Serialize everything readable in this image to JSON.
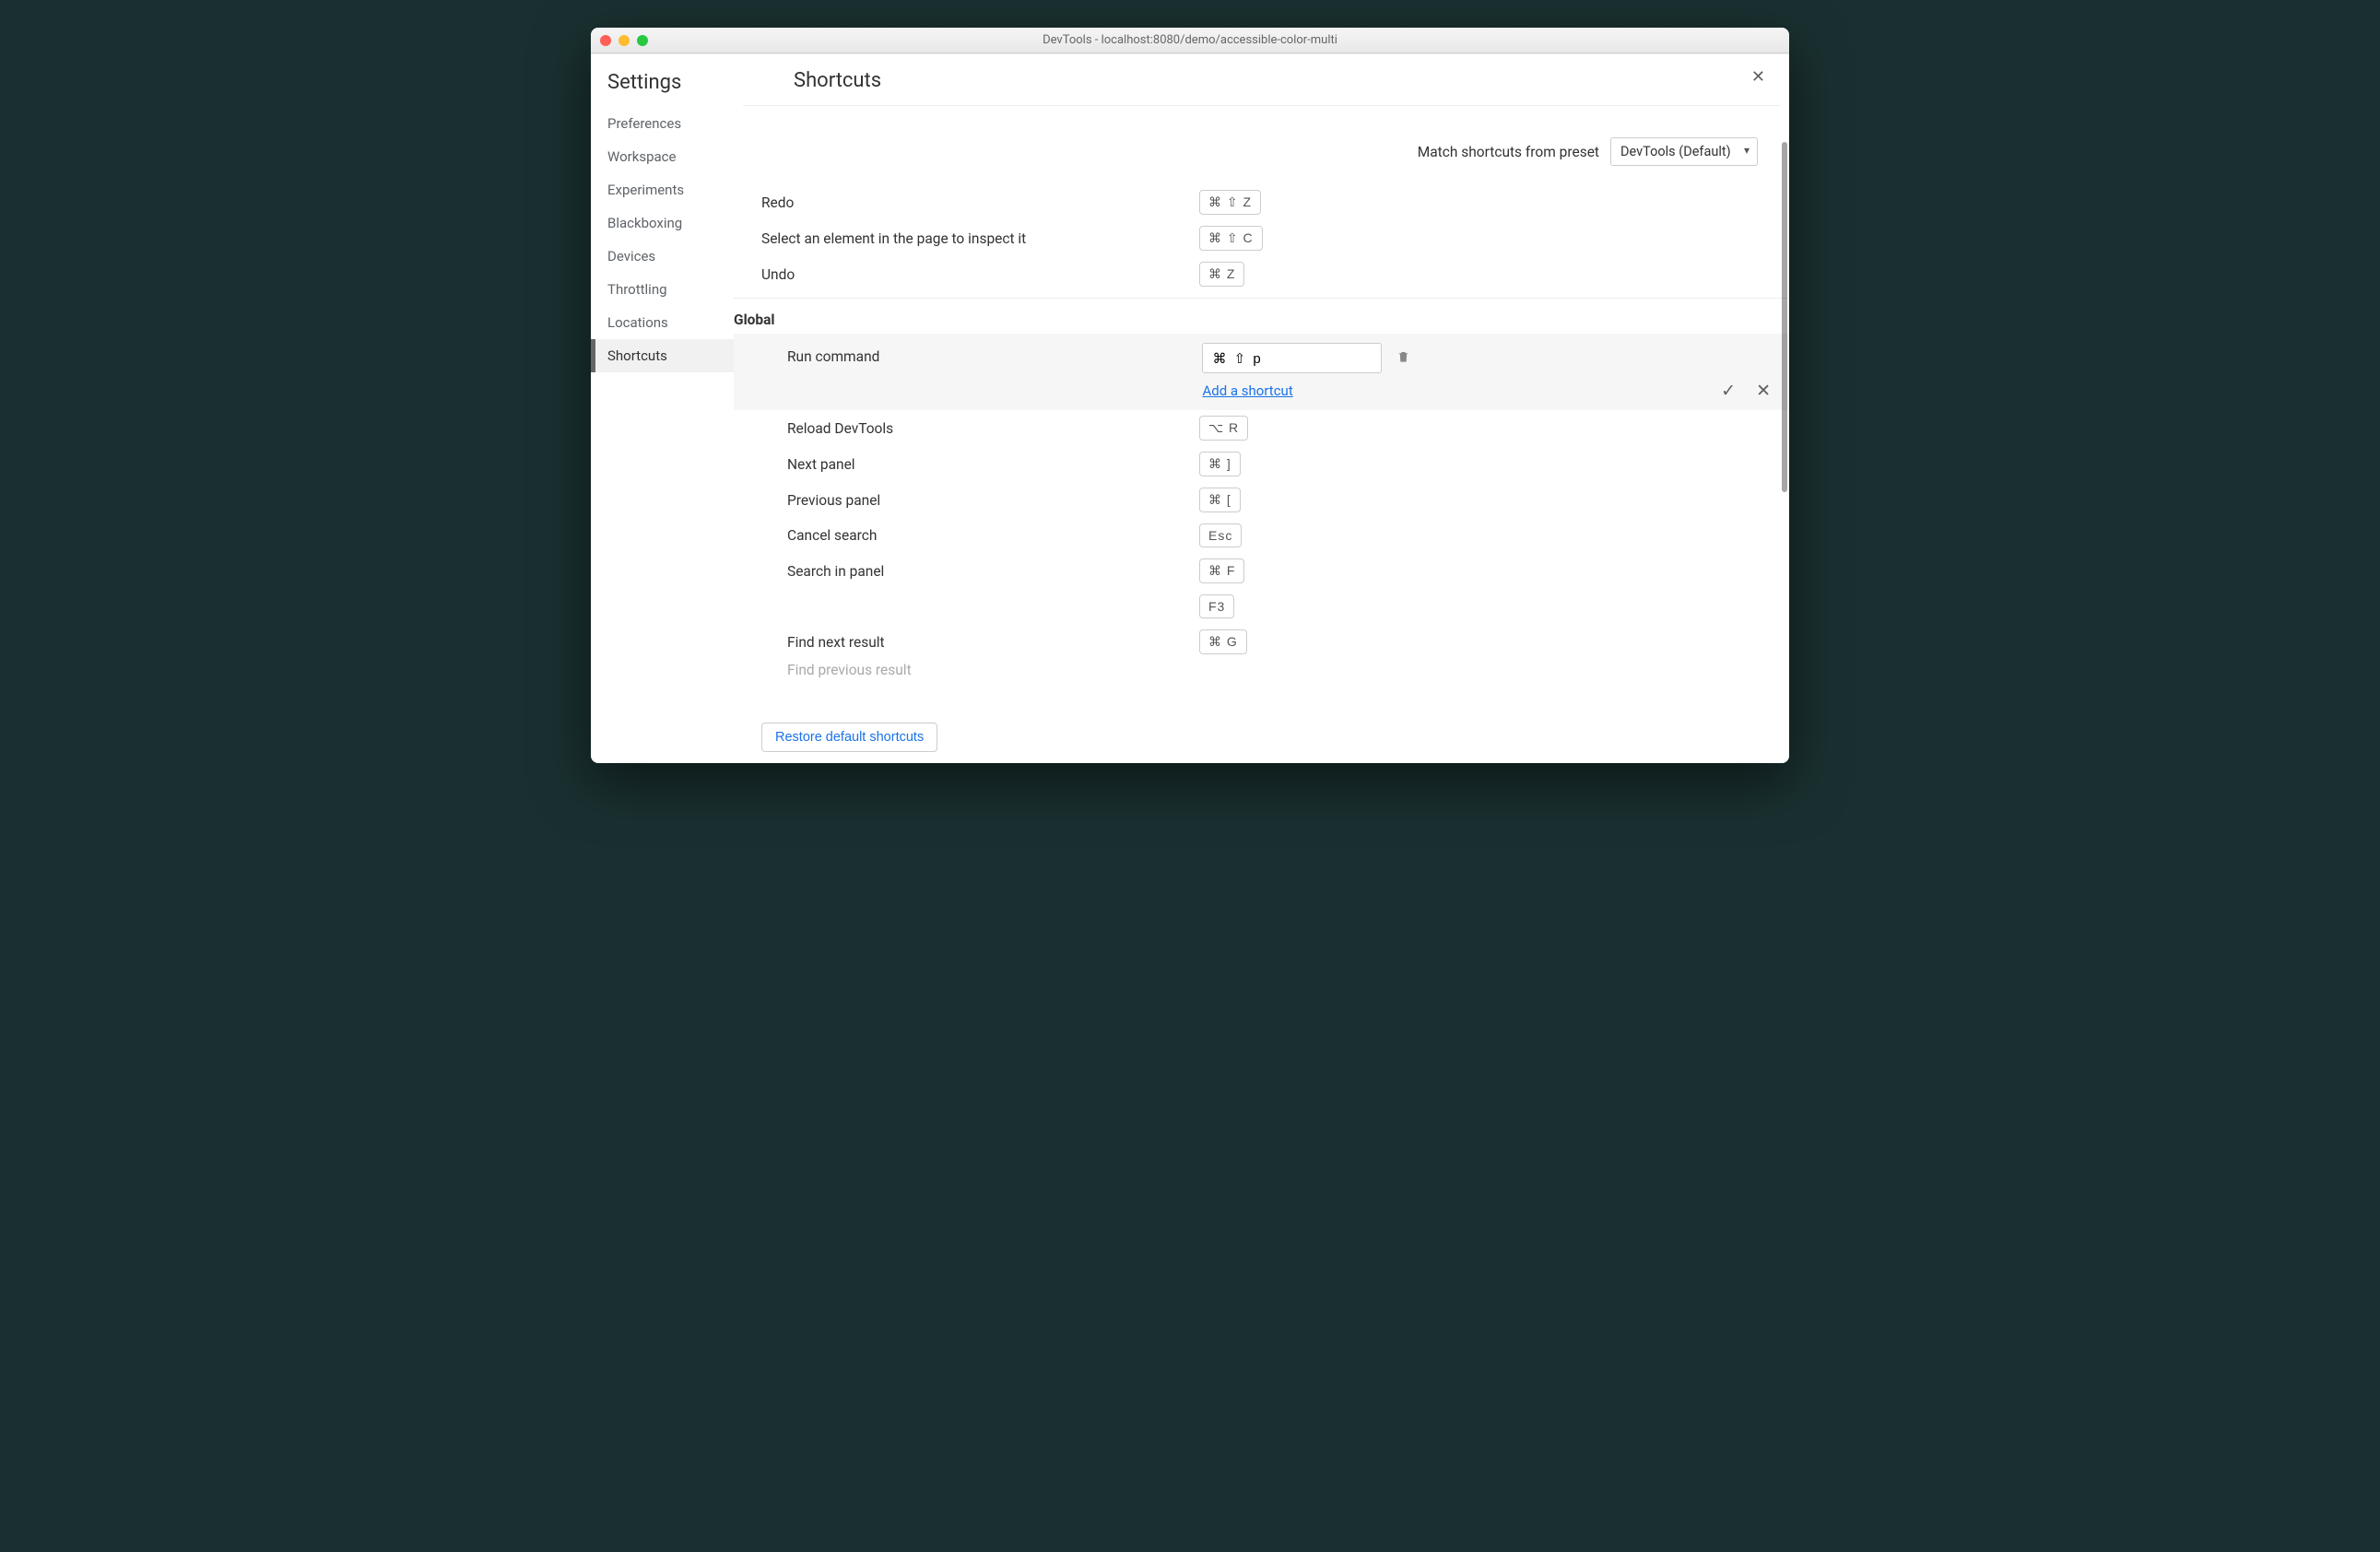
{
  "window_title": "DevTools - localhost:8080/demo/accessible-color-multi",
  "sidebar": {
    "title": "Settings",
    "items": [
      {
        "label": "Preferences"
      },
      {
        "label": "Workspace"
      },
      {
        "label": "Experiments"
      },
      {
        "label": "Blackboxing"
      },
      {
        "label": "Devices"
      },
      {
        "label": "Throttling"
      },
      {
        "label": "Locations"
      },
      {
        "label": "Shortcuts"
      }
    ]
  },
  "main": {
    "title": "Shortcuts",
    "preset_label": "Match shortcuts from preset",
    "preset_value": "DevTools (Default)"
  },
  "top_rows": [
    {
      "label": "Redo",
      "keys": "⌘ ⇧ Z"
    },
    {
      "label": "Select an element in the page to inspect it",
      "keys": "⌘ ⇧ C"
    },
    {
      "label": "Undo",
      "keys": "⌘ Z"
    }
  ],
  "section": "Global",
  "editing": {
    "label": "Run command",
    "keys": "⌘ ⇧ p",
    "add_link": "Add a shortcut"
  },
  "global_rows": [
    {
      "label": "Reload DevTools",
      "keys": "⌥ R"
    },
    {
      "label": "Next panel",
      "keys": "⌘ ]"
    },
    {
      "label": "Previous panel",
      "keys": "⌘ ["
    },
    {
      "label": "Cancel search",
      "keys": "Esc"
    },
    {
      "label": "Search in panel",
      "keys": "⌘ F"
    },
    {
      "label": "",
      "keys": "F3"
    },
    {
      "label": "Find next result",
      "keys": "⌘ G"
    }
  ],
  "truncated_row": "Find previous result",
  "footer": {
    "restore": "Restore default shortcuts"
  }
}
